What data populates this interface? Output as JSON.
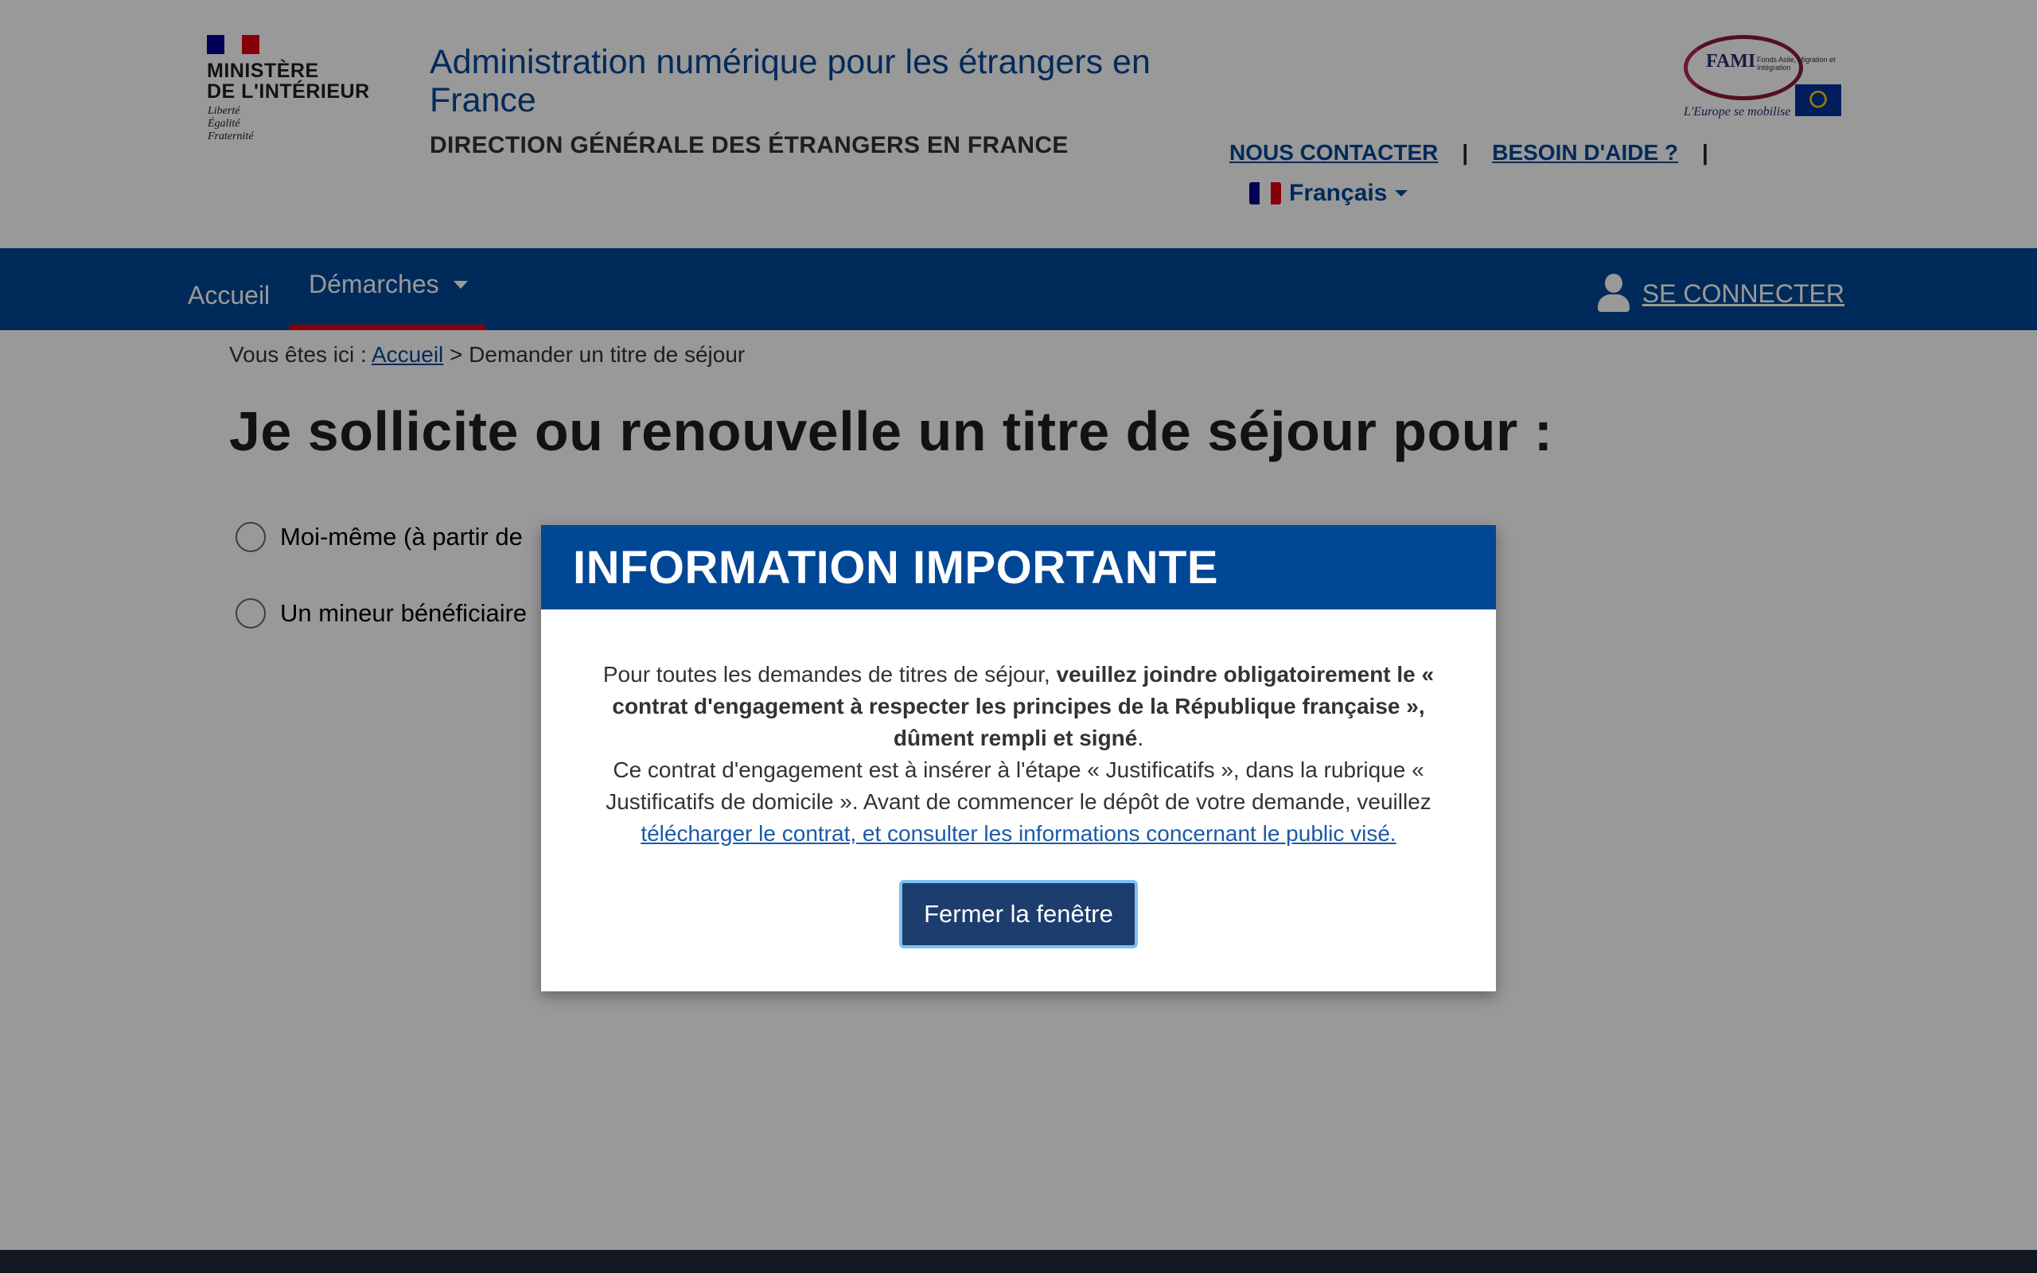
{
  "header": {
    "ministry_line1": "MINISTÈRE",
    "ministry_line2": "DE L'INTÉRIEUR",
    "motto_1": "Liberté",
    "motto_2": "Égalité",
    "motto_3": "Fraternité",
    "site_title": "Administration numérique pour les étrangers en France",
    "site_subtitle": "DIRECTION GÉNÉRALE DES ÉTRANGERS EN FRANCE",
    "contact_link": "NOUS CONTACTER",
    "separator": "|",
    "help_link": "BESOIN D'AIDE ?",
    "language": "Français",
    "fami_title": "FAMI",
    "fami_desc": "Fonds Asile, Migration et Intégration",
    "fami_union": "Union européenne",
    "fami_slogan": "L'Europe se mobilise"
  },
  "nav": {
    "home": "Accueil",
    "demarches": "Démarches",
    "connect": "SE CONNECTER"
  },
  "breadcrumb": {
    "prefix": "Vous êtes ici : ",
    "home": "Accueil",
    "current": " > Demander un titre de séjour"
  },
  "main": {
    "title": "Je sollicite ou renouvelle un titre de séjour pour :",
    "options": [
      {
        "label": "Moi-même (à partir de"
      },
      {
        "label": "Un mineur bénéficiaire"
      }
    ]
  },
  "modal": {
    "title": "INFORMATION IMPORTANTE",
    "p1_normal": "Pour toutes les demandes de titres de séjour, ",
    "p1_bold": "veuillez joindre obligatoirement le « contrat d'engagement à respecter les principes de la République française », dûment rempli et signé",
    "p1_end": ".",
    "p2": "Ce contrat d'engagement est à insérer à l'étape « Justificatifs », dans la rubrique « Justificatifs de domicile ». Avant de commencer le dépôt de votre demande, veuillez",
    "p2_link": "télécharger le contrat, et consulter les informations concernant le public visé.",
    "close_button": "Fermer la fenêtre"
  },
  "colors": {
    "primary_blue": "#004795",
    "modal_button": "#1c3d6e",
    "accent_red": "#e1000f",
    "overlay": "rgba(0,0,0,0.40)"
  }
}
